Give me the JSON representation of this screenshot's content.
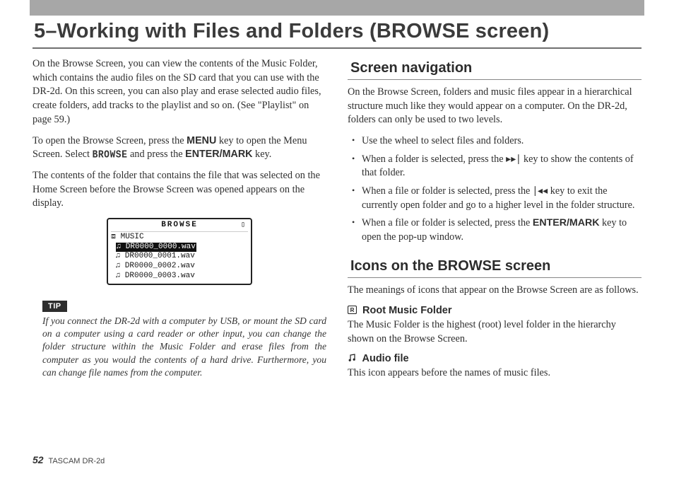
{
  "heading": "5–Working with Files and Folders (BROWSE screen)",
  "left": {
    "p1a": "On the Browse Screen, you can view the contents of the Music Folder, which contains the audio files on the SD card that you can use with the DR-2d. On this screen, you can also play and erase selected audio files, create folders, add tracks to the playlist and so on. (See \"Playlist\" on page 59.)",
    "p2a": "To open the Browse Screen, press the ",
    "p2b": "MENU",
    "p2c": " key to open the Menu Screen. Select ",
    "p2d": "BROWSE",
    "p2e": " and press the ",
    "p2f": "ENTER/MARK",
    "p2g": " key.",
    "p3": "The contents of the folder that contains the file that was selected on the Home Screen before the Browse Screen was opened appears on the display.",
    "display": {
      "title": "BROWSE",
      "root": "⧈ MUSIC",
      "sel": "♫ DR0000_0000.wav",
      "r2": " ♫ DR0000_0001.wav",
      "r3": " ♫ DR0000_0002.wav",
      "r4": " ♫ DR0000_0003.wav"
    },
    "tip_label": "TIP",
    "tip": "If you connect the DR-2d with a computer by USB, or mount the SD card on a computer using a card reader or other input, you can change the folder structure within the Music Folder and erase files from the computer as you would the contents of a hard drive. Furthermore, you can change file names from the computer."
  },
  "right": {
    "nav_h": "Screen navigation",
    "nav_p": "On the Browse Screen, folders and music files appear in a hierarchical structure much like they would appear on a computer. On the DR-2d, folders can only be used to two levels.",
    "b1": "Use the wheel to select files and folders.",
    "b2a": "When a folder is selected, press the ",
    "b2b": "▸▸∣",
    "b2c": " key to show the contents of that folder.",
    "b3a": "When a file or folder is selected, press the ",
    "b3b": "∣◂◂",
    "b3c": " key to exit the currently open folder and go to a higher level in the folder structure.",
    "b4a": "When a file or folder is selected, press the ",
    "b4b": "ENTER/MARK",
    "b4c": " key to open the pop-up window.",
    "icons_h": "Icons on the BROWSE screen",
    "icons_p": "The meanings of icons that appear on the Browse Screen are as follows.",
    "root_h": "Root Music Folder",
    "root_p": "The Music Folder is the highest (root) level folder in the hierarchy shown on the Browse Screen.",
    "audio_h": "Audio file",
    "audio_p": "This icon appears before the names of music files."
  },
  "footer": {
    "page": "52",
    "product": "TASCAM  DR-2d"
  }
}
